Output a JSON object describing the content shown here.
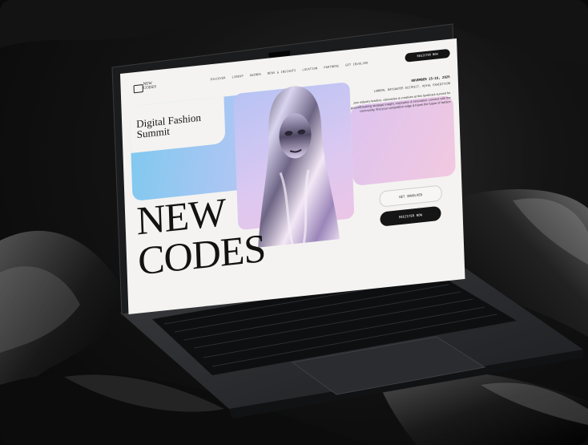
{
  "nav": {
    "logo": "NEW\nCODES",
    "links": [
      "DISCOVER",
      "LINEUP",
      "AGENDA",
      "NEWS & INSIGHTS",
      "LOCATION",
      "PARTNERS",
      "GET INVOLVED"
    ],
    "register_label": "REGISTER NOW"
  },
  "hero": {
    "title": "Digital Fashion Summit",
    "date": "NOVEMBER 15-16, 2025",
    "location": "LONDON, BAYSWATER DISTRICT, ROYAL EXHIBITION",
    "description": "Join industry leaders, visionaries & creatives at this landmark summit for groundbreaking strategic insight, inspiration & innovation; connect with the community, find your competitive edge & frame the future of fashion",
    "headline_line1": "NEW",
    "headline_line2": "CODES",
    "get_involved_label": "GET INVOLVED",
    "register_label": "REGISTER NOW"
  },
  "colors": {
    "accent_blue": "#7ec9ef",
    "accent_lilac": "#d8c0ee",
    "accent_pink": "#f2c9e0",
    "button_dark": "#151515"
  }
}
